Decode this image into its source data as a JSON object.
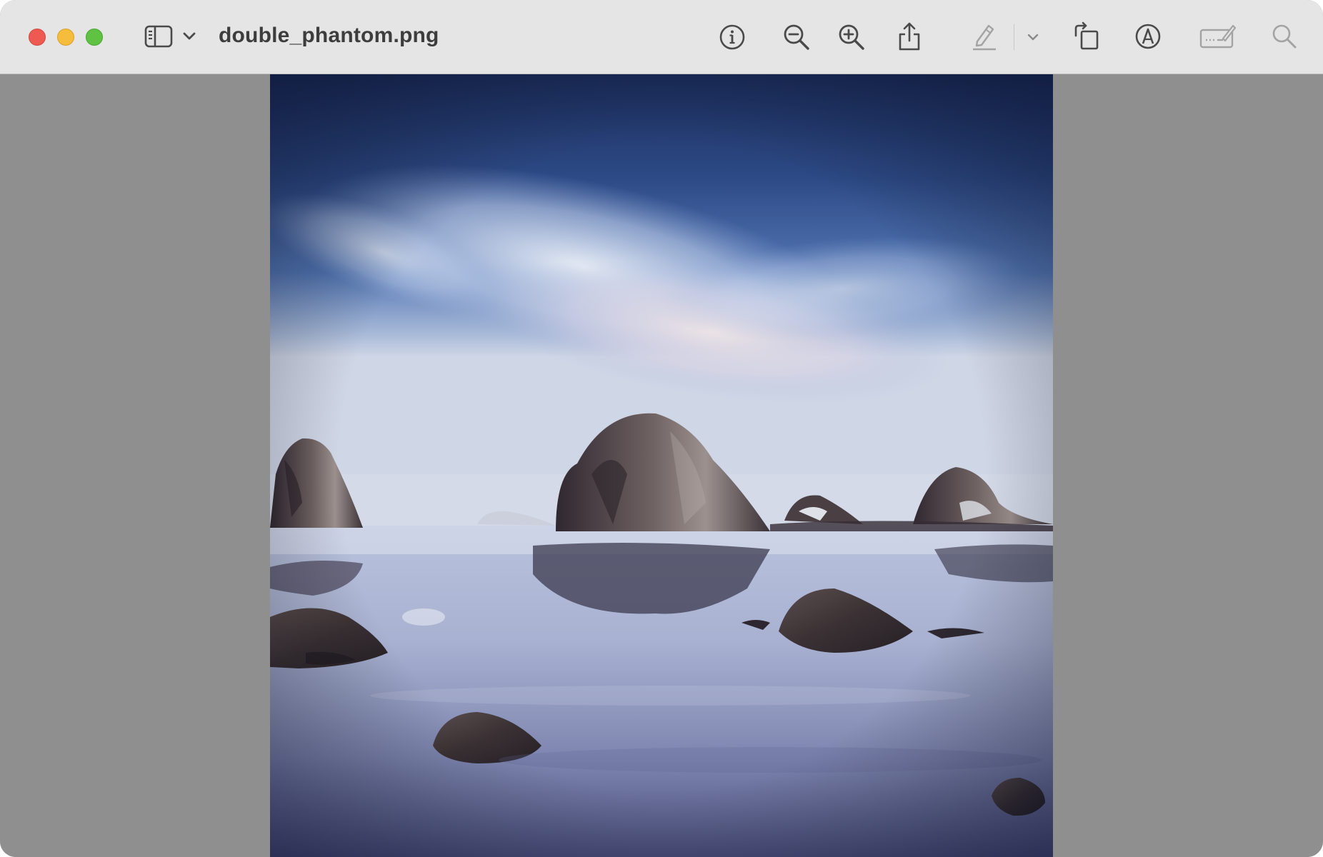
{
  "window": {
    "title": "double_phantom.png"
  },
  "toolbar": {
    "icons": [
      "sidebar-toggle-icon",
      "chevron-down-icon",
      "info-icon",
      "zoom-out-icon",
      "zoom-in-icon",
      "share-icon",
      "highlight-pen-icon",
      "chevron-down-icon",
      "rotate-icon",
      "markup-icon",
      "signature-icon",
      "search-icon"
    ]
  },
  "image": {
    "subject": "seascape"
  },
  "colors": {
    "titlebar": "#e6e5e5",
    "backdrop": "#8f8f8f",
    "close": "#ee5a52",
    "minimize": "#f5bd3b",
    "zoom": "#5fc243"
  }
}
